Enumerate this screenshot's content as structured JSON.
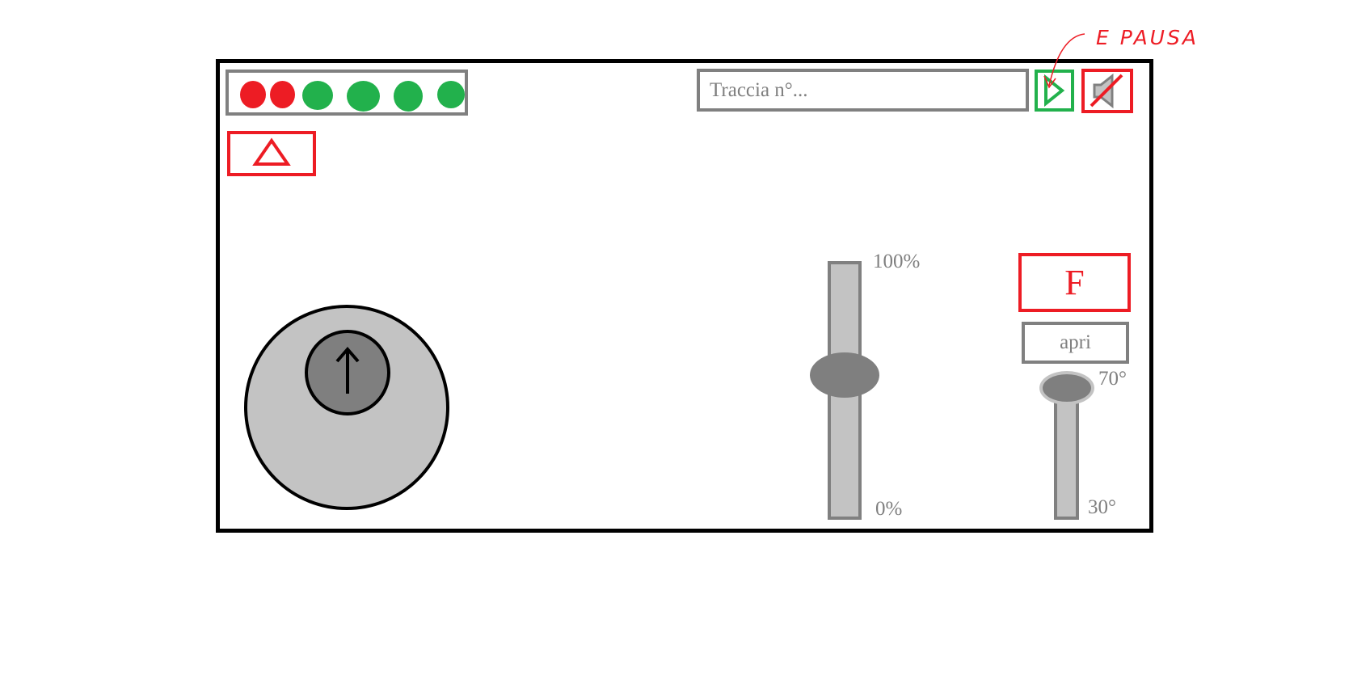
{
  "status_lights": [
    {
      "color": "#ed1c24",
      "state": "red"
    },
    {
      "color": "#ed1c24",
      "state": "red"
    },
    {
      "color": "#22b14c",
      "state": "green"
    },
    {
      "color": "#22b14c",
      "state": "green"
    },
    {
      "color": "#22b14c",
      "state": "green"
    },
    {
      "color": "#22b14c",
      "state": "green"
    }
  ],
  "track_input": {
    "placeholder": "Traccia n°...",
    "value": ""
  },
  "play_button": {
    "icon": "play-icon",
    "color": "#22b14c"
  },
  "mute_button": {
    "icon": "speaker-muted-icon",
    "color": "#ed1c24"
  },
  "annotation": {
    "text": "E PAUSA",
    "color": "#ed1c24"
  },
  "hazard_button": {
    "icon": "warning-triangle-icon",
    "color": "#ed1c24"
  },
  "joystick": {
    "icon": "arrow-up-icon",
    "base_color": "#c3c3c3",
    "knob_color": "#7f7f7f"
  },
  "throttle_slider": {
    "max_label": "100%",
    "min_label": "0%",
    "level_percent": 56
  },
  "f_button": {
    "label": "F",
    "color": "#ed1c24"
  },
  "open_button": {
    "label": "apri"
  },
  "angle_slider": {
    "max_label": "70°",
    "min_label": "30°",
    "value_deg": 66
  }
}
